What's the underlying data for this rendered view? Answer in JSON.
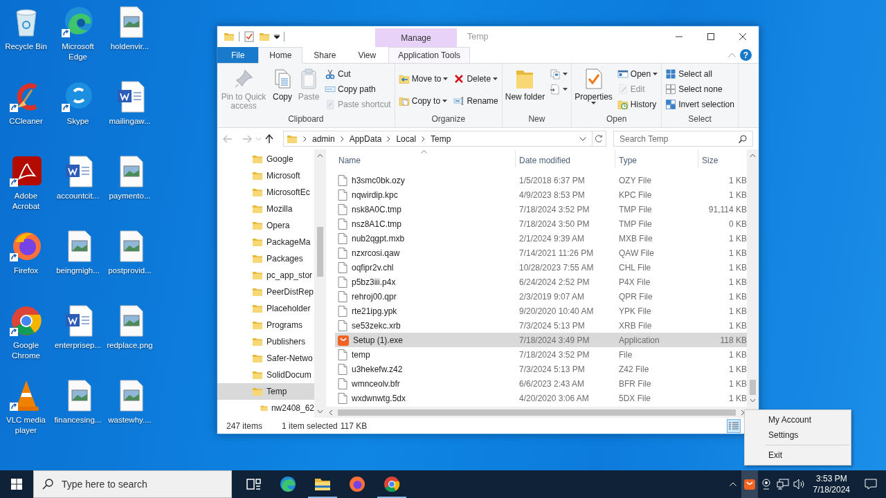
{
  "desktop": {
    "icons": [
      {
        "label": "Recycle Bin",
        "kind": "recycle",
        "shortcut": false
      },
      {
        "label": "CCleaner",
        "kind": "ccleaner",
        "shortcut": true
      },
      {
        "label": "Adobe Acrobat",
        "kind": "acrobat",
        "shortcut": true
      },
      {
        "label": "Firefox",
        "kind": "firefox",
        "shortcut": true
      },
      {
        "label": "Google Chrome",
        "kind": "chrome",
        "shortcut": true
      },
      {
        "label": "VLC media player",
        "kind": "vlc",
        "shortcut": true
      },
      {
        "label": "Microsoft Edge",
        "kind": "edge",
        "shortcut": true
      },
      {
        "label": "Skype",
        "kind": "skype",
        "shortcut": true
      },
      {
        "label": "accountcit...",
        "kind": "word",
        "shortcut": false
      },
      {
        "label": "beingmigh...",
        "kind": "image",
        "shortcut": false
      },
      {
        "label": "enterprisep...",
        "kind": "word",
        "shortcut": false
      },
      {
        "label": "financesing...",
        "kind": "image",
        "shortcut": false
      },
      {
        "label": "holdenvir...",
        "kind": "image",
        "shortcut": false
      },
      {
        "label": "mailingaw...",
        "kind": "word",
        "shortcut": false
      },
      {
        "label": "paymento...",
        "kind": "image",
        "shortcut": false
      },
      {
        "label": "postprovid...",
        "kind": "image",
        "shortcut": false
      },
      {
        "label": "redplace.png",
        "kind": "image",
        "shortcut": false
      },
      {
        "label": "wastewhy....",
        "kind": "image",
        "shortcut": false
      }
    ]
  },
  "window": {
    "title": "Temp",
    "context_header": "Manage",
    "help": "?",
    "tabs": [
      {
        "label": "File",
        "kind": "file",
        "selected": false
      },
      {
        "label": "Home",
        "kind": "normal",
        "selected": true
      },
      {
        "label": "Share",
        "kind": "normal",
        "selected": false
      },
      {
        "label": "View",
        "kind": "normal",
        "selected": false
      },
      {
        "label": "Application Tools",
        "kind": "context",
        "selected": false
      }
    ],
    "ribbon": [
      {
        "label": "Clipboard",
        "columns": [
          {
            "kind": "large",
            "items": [
              {
                "label": "Pin to Quick access",
                "kind": "pin",
                "disabled": true,
                "dropdown": false
              }
            ]
          },
          {
            "kind": "large",
            "items": [
              {
                "label": "Copy",
                "kind": "copy",
                "disabled": false,
                "dropdown": false
              }
            ]
          },
          {
            "kind": "large",
            "items": [
              {
                "label": "Paste",
                "kind": "paste",
                "disabled": true,
                "dropdown": false
              }
            ]
          },
          {
            "kind": "stack",
            "items": [
              {
                "label": "Cut",
                "kind": "cut",
                "disabled": false,
                "dropdown": false
              },
              {
                "label": "Copy path",
                "kind": "copy-path",
                "disabled": false,
                "dropdown": false
              },
              {
                "label": "Paste shortcut",
                "kind": "paste-shortcut",
                "disabled": true,
                "dropdown": false
              }
            ]
          }
        ]
      },
      {
        "label": "Organize",
        "columns": [
          {
            "kind": "stack2",
            "items": [
              {
                "label": "Move to",
                "kind": "move-to",
                "disabled": false,
                "dropdown": true
              },
              {
                "label": "Copy to",
                "kind": "copy-to",
                "disabled": false,
                "dropdown": true
              }
            ]
          },
          {
            "kind": "stack2",
            "items": [
              {
                "label": "Delete",
                "kind": "delete",
                "disabled": false,
                "dropdown": true
              },
              {
                "label": "Rename",
                "kind": "rename",
                "disabled": false,
                "dropdown": false
              }
            ]
          }
        ]
      },
      {
        "label": "New",
        "columns": [
          {
            "kind": "large",
            "items": [
              {
                "label": "New folder",
                "kind": "new-folder",
                "disabled": false,
                "dropdown": false
              }
            ]
          },
          {
            "kind": "stack",
            "items": [
              {
                "kind": "new-item",
                "disabled": false,
                "dropdown": true
              },
              {
                "kind": "easy-access",
                "disabled": false,
                "dropdown": true
              }
            ]
          }
        ]
      },
      {
        "label": "Open",
        "columns": [
          {
            "kind": "large",
            "items": [
              {
                "label": "Properties",
                "kind": "properties",
                "disabled": false,
                "dropdown": true
              }
            ]
          },
          {
            "kind": "stack",
            "items": [
              {
                "label": "Open",
                "kind": "open",
                "disabled": false,
                "dropdown": true
              },
              {
                "label": "Edit",
                "kind": "edit",
                "disabled": true,
                "dropdown": false
              },
              {
                "label": "History",
                "kind": "history",
                "disabled": false,
                "dropdown": false
              }
            ]
          }
        ]
      },
      {
        "label": "Select",
        "columns": [
          {
            "kind": "stack",
            "items": [
              {
                "label": "Select all",
                "kind": "select-all",
                "disabled": false,
                "dropdown": false
              },
              {
                "label": "Select none",
                "kind": "select-none",
                "disabled": false,
                "dropdown": false
              },
              {
                "label": "Invert selection",
                "kind": "invert",
                "disabled": false,
                "dropdown": false
              }
            ]
          }
        ]
      }
    ],
    "address": {
      "crumbs": [
        "admin",
        "AppData",
        "Local",
        "Temp"
      ],
      "search_placeholder": "Search Temp"
    },
    "sidebar": [
      {
        "label": "Google",
        "selected": false
      },
      {
        "label": "Microsoft",
        "selected": false
      },
      {
        "label": "MicrosoftEc",
        "selected": false
      },
      {
        "label": "Mozilla",
        "selected": false
      },
      {
        "label": "Opera",
        "selected": false
      },
      {
        "label": "PackageMa",
        "selected": false
      },
      {
        "label": "Packages",
        "selected": false
      },
      {
        "label": "pc_app_stor",
        "selected": false
      },
      {
        "label": "PeerDistRep",
        "selected": false
      },
      {
        "label": "Placeholder",
        "selected": false
      },
      {
        "label": "Programs",
        "selected": false
      },
      {
        "label": "Publishers",
        "selected": false
      },
      {
        "label": "Safer-Netwo",
        "selected": false
      },
      {
        "label": "SolidDocum",
        "selected": false
      },
      {
        "label": "Temp",
        "selected": true,
        "children": [
          {
            "label": "nw2408_62",
            "selected": false
          }
        ]
      }
    ],
    "columns": [
      "Name",
      "Date modified",
      "Type",
      "Size"
    ],
    "rows": [
      {
        "name": "h3smc0bk.ozy",
        "date": "1/5/2018 6:37 PM",
        "type": "OZY File",
        "size": "1 KB",
        "kind": "file",
        "selected": false
      },
      {
        "name": "nqwirdip.kpc",
        "date": "4/9/2023 8:53 PM",
        "type": "KPC File",
        "size": "1 KB",
        "kind": "file",
        "selected": false
      },
      {
        "name": "nsk8A0C.tmp",
        "date": "7/18/2024 3:52 PM",
        "type": "TMP File",
        "size": "91,114 KB",
        "kind": "file",
        "selected": false
      },
      {
        "name": "nsz8A1C.tmp",
        "date": "7/18/2024 3:50 PM",
        "type": "TMP File",
        "size": "0 KB",
        "kind": "file",
        "selected": false
      },
      {
        "name": "nub2qgpt.mxb",
        "date": "2/1/2024 9:39 AM",
        "type": "MXB File",
        "size": "1 KB",
        "kind": "file",
        "selected": false
      },
      {
        "name": "nzxrcosi.qaw",
        "date": "7/14/2021 11:26 PM",
        "type": "QAW File",
        "size": "1 KB",
        "kind": "file",
        "selected": false
      },
      {
        "name": "oqfipr2v.chl",
        "date": "10/28/2023 7:55 AM",
        "type": "CHL File",
        "size": "1 KB",
        "kind": "file",
        "selected": false
      },
      {
        "name": "p5bz3iii.p4x",
        "date": "6/24/2024 2:52 PM",
        "type": "P4X File",
        "size": "1 KB",
        "kind": "file",
        "selected": false
      },
      {
        "name": "rehroj00.qpr",
        "date": "2/3/2019 9:07 AM",
        "type": "QPR File",
        "size": "1 KB",
        "kind": "file",
        "selected": false
      },
      {
        "name": "rte21ipg.ypk",
        "date": "9/20/2020 10:40 AM",
        "type": "YPK File",
        "size": "1 KB",
        "kind": "file",
        "selected": false
      },
      {
        "name": "se53zekc.xrb",
        "date": "7/3/2024 5:13 PM",
        "type": "XRB File",
        "size": "1 KB",
        "kind": "file",
        "selected": false
      },
      {
        "name": "Setup (1).exe",
        "date": "7/18/2024 3:49 PM",
        "type": "Application",
        "size": "118 KB",
        "kind": "app",
        "selected": true
      },
      {
        "name": "temp",
        "date": "7/18/2024 3:52 PM",
        "type": "File",
        "size": "1 KB",
        "kind": "file",
        "selected": false
      },
      {
        "name": "u3hekefw.z42",
        "date": "7/3/2024 5:13 PM",
        "type": "Z42 File",
        "size": "1 KB",
        "kind": "file",
        "selected": false
      },
      {
        "name": "wmnceolv.bfr",
        "date": "6/6/2023 2:43 AM",
        "type": "BFR File",
        "size": "1 KB",
        "kind": "file",
        "selected": false
      },
      {
        "name": "wxdwnwtg.5dx",
        "date": "4/20/2020 3:06 AM",
        "type": "5DX File",
        "size": "1 KB",
        "kind": "file",
        "selected": false
      }
    ],
    "status": {
      "count": "247 items",
      "selection": "1 item selected",
      "selection_size": "117 KB"
    }
  },
  "context_menu": [
    {
      "label": "My Account",
      "separator_before": false
    },
    {
      "label": "Settings",
      "separator_before": false
    },
    {
      "label": "Exit",
      "separator_before": true
    }
  ],
  "taskbar": {
    "search_placeholder": "Type here to search",
    "apps": [
      {
        "kind": "task-view",
        "running": false
      },
      {
        "kind": "edge",
        "running": false
      },
      {
        "kind": "explorer",
        "running": true
      },
      {
        "kind": "firefox",
        "running": false
      },
      {
        "kind": "chrome",
        "running": true
      }
    ],
    "time": "3:53 PM",
    "date": "7/18/2024"
  }
}
